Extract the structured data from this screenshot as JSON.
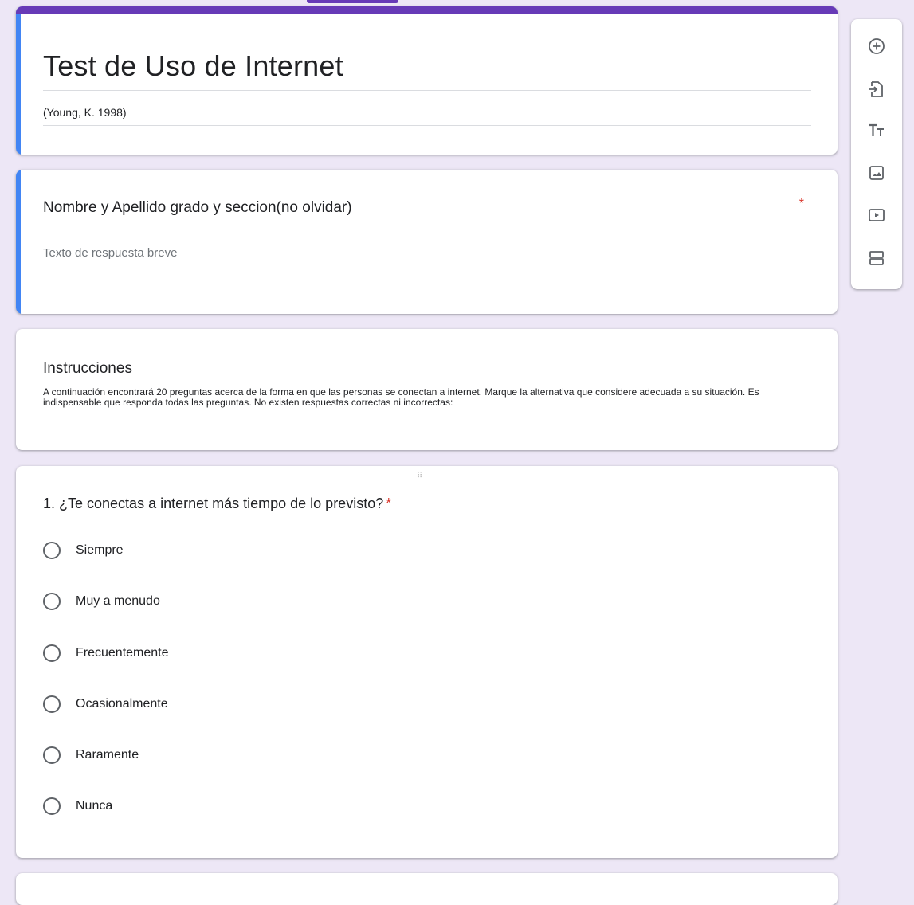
{
  "form": {
    "title": "Test de Uso de Internet",
    "description": "(Young, K. 1998)"
  },
  "name_question": {
    "title": "Nombre y Apellido grado y seccion(no olvidar)",
    "required_mark": "*",
    "placeholder": "Texto de respuesta breve"
  },
  "instructions": {
    "title": "Instrucciones",
    "text": "A continuación encontrará 20 preguntas acerca de la forma en que las personas se conectan a internet. Marque la alternativa que considere adecuada a su situación. Es indispensable que responda todas las preguntas. No existen respuestas correctas ni incorrectas:"
  },
  "question1": {
    "drag_handle": "⠿",
    "title": "1. ¿Te conectas a internet más tiempo de lo previsto?",
    "required_mark": "*",
    "options": [
      "Siempre",
      "Muy a menudo",
      "Frecuentemente",
      "Ocasionalmente",
      "Raramente",
      "Nunca"
    ]
  },
  "toolbar": {
    "icons": [
      "add-question-icon",
      "import-questions-icon",
      "add-title-icon",
      "add-image-icon",
      "add-video-icon",
      "add-section-icon"
    ]
  },
  "colors": {
    "theme": "#673ab7",
    "background": "#ede7f6",
    "active_card": "#4285f4",
    "required": "#d93025"
  }
}
